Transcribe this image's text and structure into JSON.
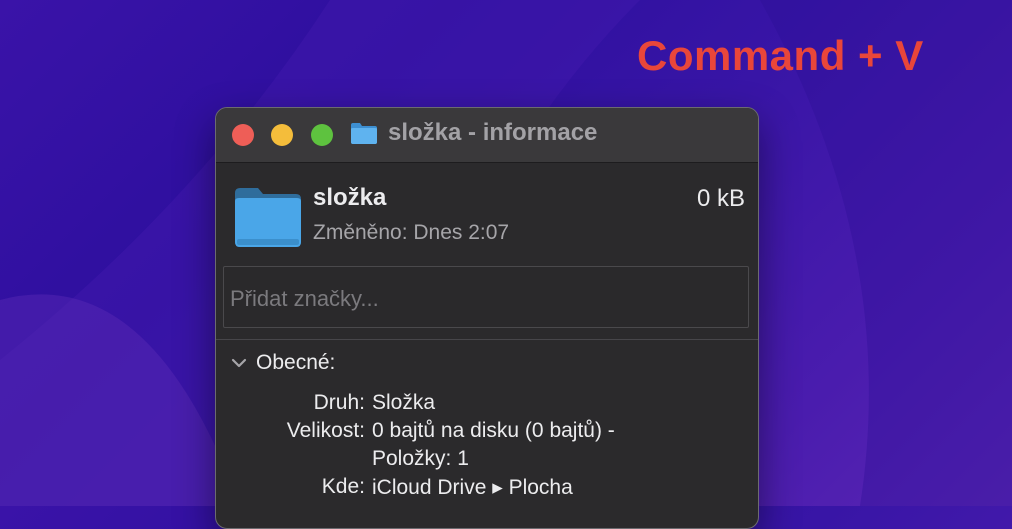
{
  "overlay": {
    "caption": "Command + V"
  },
  "window": {
    "title": "složka - informace",
    "title_icon": "folder-icon"
  },
  "file": {
    "name": "složka",
    "size": "0 kB",
    "modified": "Změněno: Dnes 2:07",
    "icon": "folder-icon"
  },
  "tags": {
    "placeholder": "Přidat značky..."
  },
  "general": {
    "section_label": "Obecné:",
    "rows": [
      {
        "key": "Druh:",
        "value": "Složka"
      },
      {
        "key": "Velikost:",
        "value": "0 bajtů na disku (0 bajtů) -"
      },
      {
        "key": "",
        "value": "Položky: 1"
      },
      {
        "key": "Kde:",
        "value": "iCloud Drive ▸ Plocha"
      }
    ]
  },
  "colors": {
    "caption": "#e9463a",
    "close": "#ee5e57",
    "minimize": "#f4bd3b",
    "zoom": "#5ec23f",
    "folder": "#4aa6e8"
  }
}
